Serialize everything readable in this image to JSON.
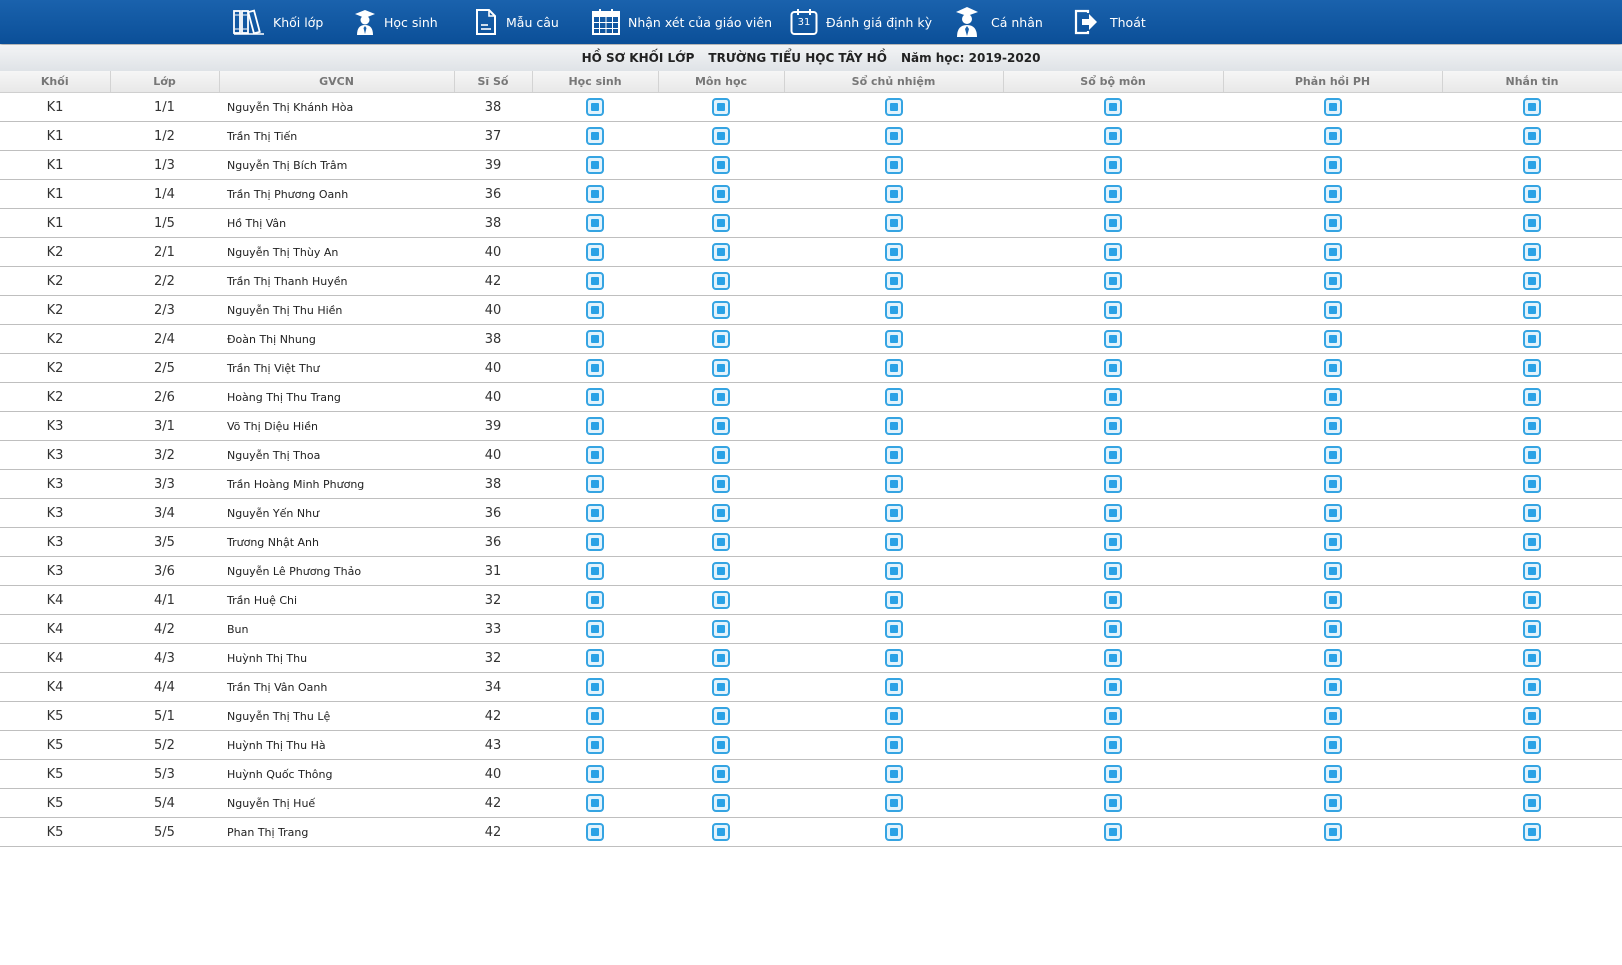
{
  "nav": [
    {
      "label": "Khối lớp",
      "icon": "books-icon"
    },
    {
      "label": "Học sinh",
      "icon": "student-icon"
    },
    {
      "label": "Mẫu câu",
      "icon": "document-icon"
    },
    {
      "label": "Nhận xét của giáo viên",
      "icon": "calendar-grid-icon"
    },
    {
      "label": "Đánh giá định kỳ",
      "icon": "calendar-31-icon",
      "day": "31"
    },
    {
      "label": "Cá nhân",
      "icon": "graduate-icon"
    },
    {
      "label": "Thoát",
      "icon": "logout-icon"
    }
  ],
  "header": {
    "title": "HỒ SƠ KHỐI LỚP",
    "school": "TRƯỜNG TIỂU HỌC TÂY HỒ",
    "year": "Năm học: 2019-2020"
  },
  "columns": [
    "Khối",
    "Lớp",
    "GVCN",
    "Sĩ Số",
    "Học sinh",
    "Môn học",
    "Sổ chủ nhiệm",
    "Sổ bộ môn",
    "Phản hồi PH",
    "Nhắn tin"
  ],
  "rows": [
    {
      "khoi": "K1",
      "lop": "1/1",
      "gvcn": "Nguyễn Thị Khánh Hòa",
      "siso": "38"
    },
    {
      "khoi": "K1",
      "lop": "1/2",
      "gvcn": "Trần Thị Tiến",
      "siso": "37"
    },
    {
      "khoi": "K1",
      "lop": "1/3",
      "gvcn": "Nguyễn Thị Bích Trâm",
      "siso": "39"
    },
    {
      "khoi": "K1",
      "lop": "1/4",
      "gvcn": "Trần Thị Phương Oanh",
      "siso": "36"
    },
    {
      "khoi": "K1",
      "lop": "1/5",
      "gvcn": "Hồ Thị Vân",
      "siso": "38"
    },
    {
      "khoi": "K2",
      "lop": "2/1",
      "gvcn": "Nguyễn Thị Thùy An",
      "siso": "40"
    },
    {
      "khoi": "K2",
      "lop": "2/2",
      "gvcn": "Trần Thị Thanh Huyền",
      "siso": "42"
    },
    {
      "khoi": "K2",
      "lop": "2/3",
      "gvcn": "Nguyễn Thị Thu Hiền",
      "siso": "40"
    },
    {
      "khoi": "K2",
      "lop": "2/4",
      "gvcn": "Đoàn Thị Nhung",
      "siso": "38"
    },
    {
      "khoi": "K2",
      "lop": "2/5",
      "gvcn": "Trần Thị Việt Thư",
      "siso": "40"
    },
    {
      "khoi": "K2",
      "lop": "2/6",
      "gvcn": "Hoàng Thị Thu Trang",
      "siso": "40"
    },
    {
      "khoi": "K3",
      "lop": "3/1",
      "gvcn": "Võ Thị Diệu Hiền",
      "siso": "39"
    },
    {
      "khoi": "K3",
      "lop": "3/2",
      "gvcn": "Nguyễn Thị Thoa",
      "siso": "40"
    },
    {
      "khoi": "K3",
      "lop": "3/3",
      "gvcn": "Trần Hoàng Minh Phương",
      "siso": "38"
    },
    {
      "khoi": "K3",
      "lop": "3/4",
      "gvcn": "Nguyễn Yến Như",
      "siso": "36"
    },
    {
      "khoi": "K3",
      "lop": "3/5",
      "gvcn": "Trương Nhật Anh",
      "siso": "36"
    },
    {
      "khoi": "K3",
      "lop": "3/6",
      "gvcn": "Nguyễn Lê Phương Thảo",
      "siso": "31"
    },
    {
      "khoi": "K4",
      "lop": "4/1",
      "gvcn": "Trần Huệ Chi",
      "siso": "32"
    },
    {
      "khoi": "K4",
      "lop": "4/2",
      "gvcn": "Bun",
      "siso": "33"
    },
    {
      "khoi": "K4",
      "lop": "4/3",
      "gvcn": "Huỳnh Thị Thu",
      "siso": "32"
    },
    {
      "khoi": "K4",
      "lop": "4/4",
      "gvcn": "Trần Thị Vân Oanh",
      "siso": "34"
    },
    {
      "khoi": "K5",
      "lop": "5/1",
      "gvcn": "Nguyễn Thị Thu Lệ",
      "siso": "42"
    },
    {
      "khoi": "K5",
      "lop": "5/2",
      "gvcn": "Huỳnh Thị Thu Hà",
      "siso": "43"
    },
    {
      "khoi": "K5",
      "lop": "5/3",
      "gvcn": "Huỳnh Quốc Thông",
      "siso": "40"
    },
    {
      "khoi": "K5",
      "lop": "5/4",
      "gvcn": "Nguyễn Thị Huế",
      "siso": "42"
    },
    {
      "khoi": "K5",
      "lop": "5/5",
      "gvcn": "Phan Thị Trang",
      "siso": "42"
    }
  ],
  "action_icon": "view-icon",
  "colors": {
    "topbar": "#0f58a3",
    "icon": "#2aa2e6",
    "header_bg": "#e8e8e8"
  }
}
